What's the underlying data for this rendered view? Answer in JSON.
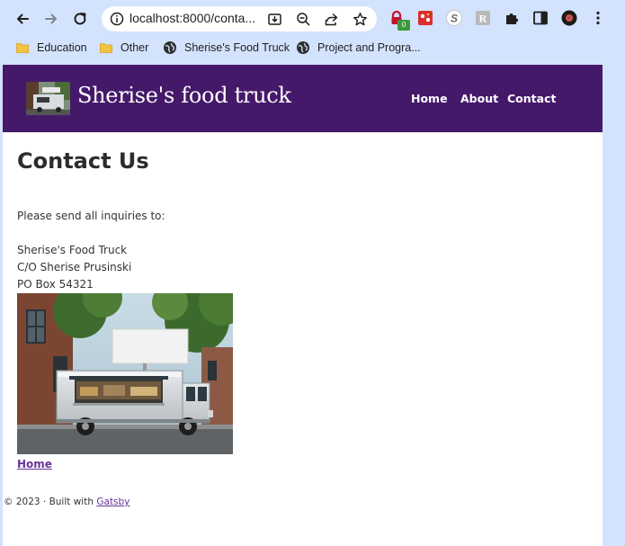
{
  "browser": {
    "url": "localhost:8000/conta...",
    "extension_badge": "0",
    "bookmarks": [
      {
        "label": "Education",
        "icon": "folder-icon"
      },
      {
        "label": "Other",
        "icon": "folder-icon"
      },
      {
        "label": "Sherise's Food Truck",
        "icon": "globe-icon"
      },
      {
        "label": "Project and Progra...",
        "icon": "globe-icon"
      }
    ]
  },
  "site": {
    "title": "Sherise's food truck",
    "nav": [
      {
        "label": "Home"
      },
      {
        "label": "About"
      },
      {
        "label": "Contact"
      }
    ]
  },
  "page": {
    "heading": "Contact Us",
    "intro": "Please send all inquiries to:",
    "address": [
      "Sherise's Food Truck",
      "C/O Sherise Prusinski",
      "PO Box 54321"
    ],
    "home_link": "Home"
  },
  "footer": {
    "text": "© 2023 · Built with ",
    "link": "Gatsby"
  },
  "colors": {
    "header_bg": "#45196a",
    "link": "#663399",
    "chrome_bg": "#d3e3fd"
  }
}
